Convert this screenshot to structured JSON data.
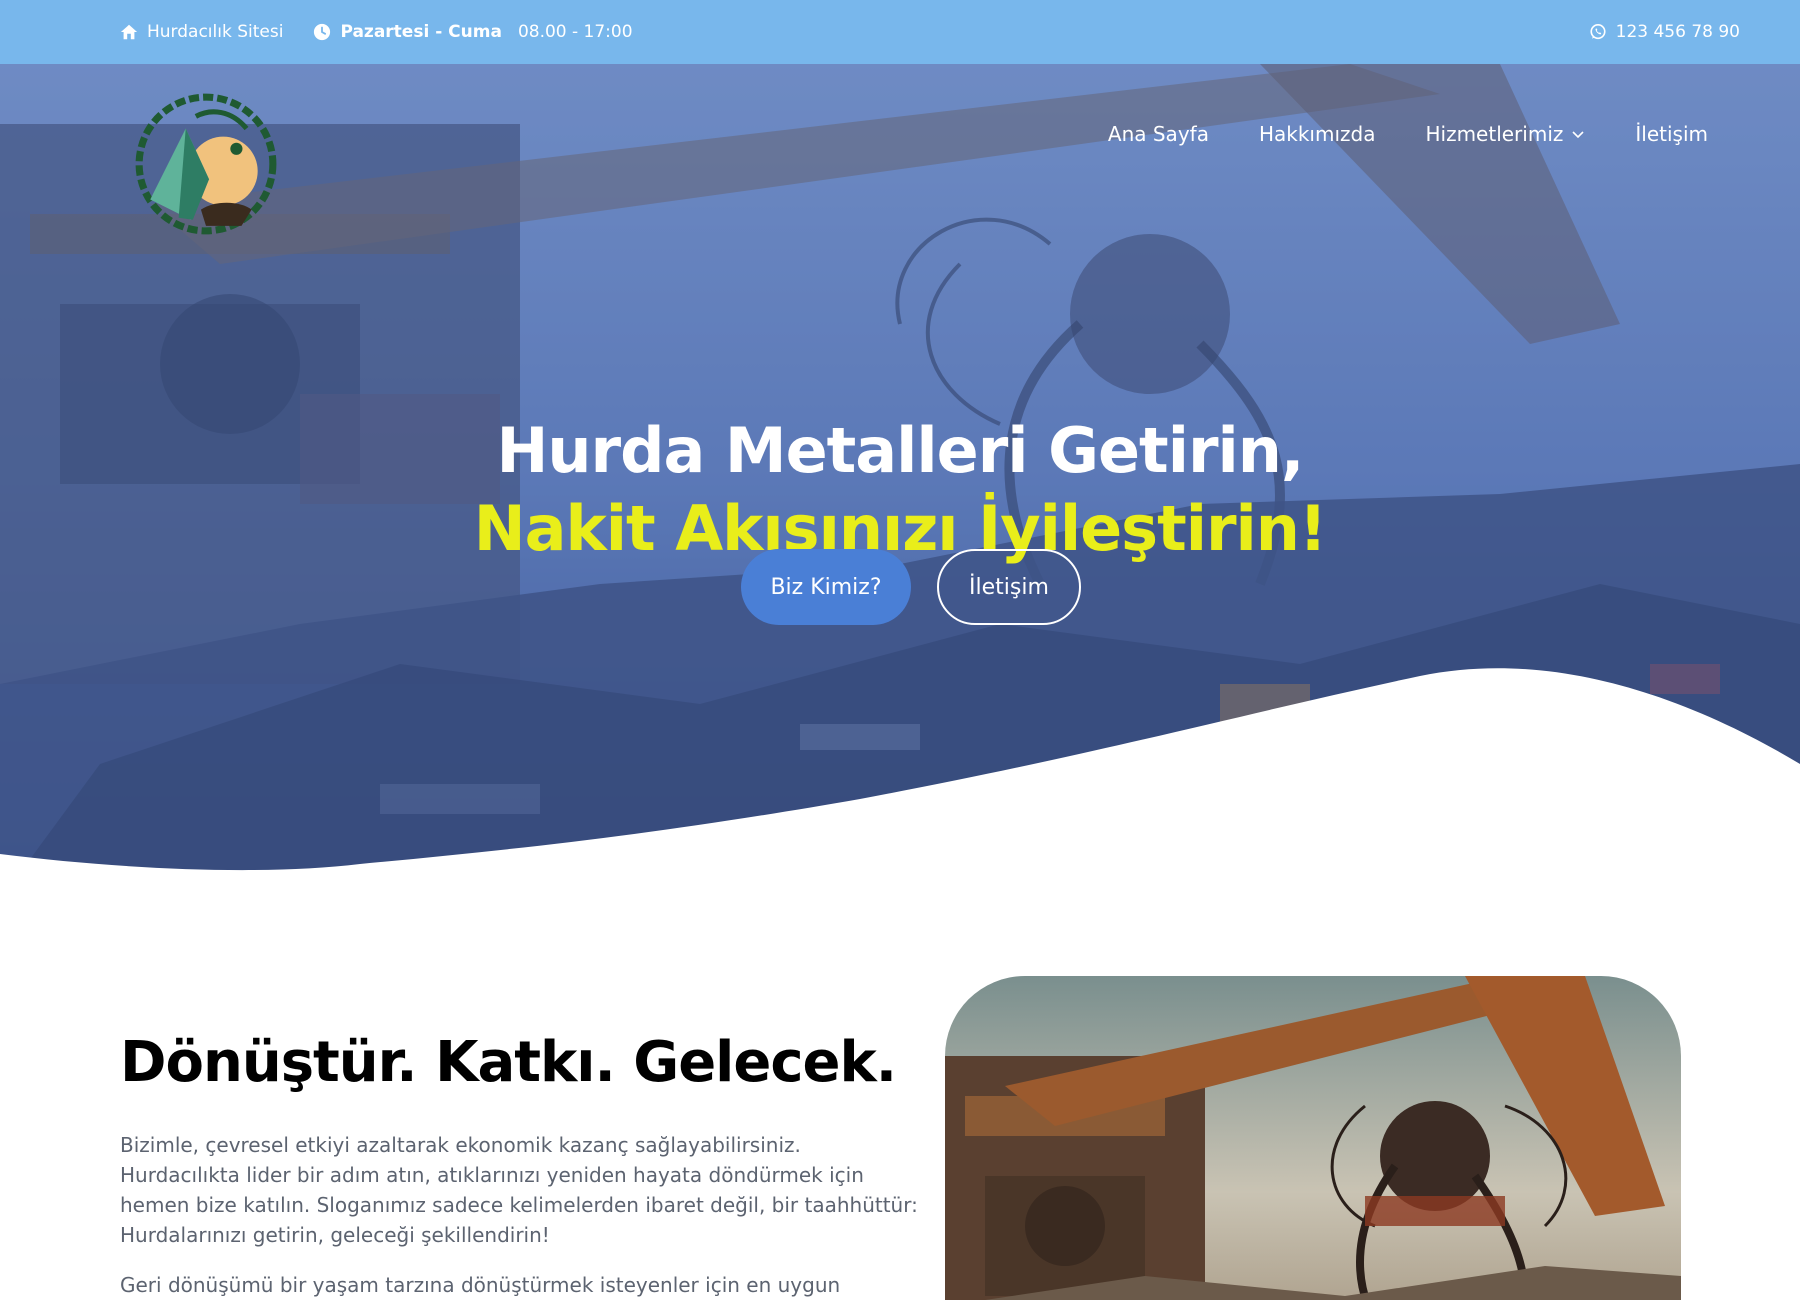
{
  "topbar": {
    "site_name": "Hurdacılık Sitesi",
    "days": "Pazartesi - Cuma",
    "hours": "08.00 - 17:00",
    "phone": "123 456 78 90",
    "background": "#78b7ec"
  },
  "nav": {
    "items": [
      {
        "label": "Ana Sayfa"
      },
      {
        "label": "Hakkımızda"
      },
      {
        "label": "Hizmetlerimiz"
      },
      {
        "label": "İletişim"
      }
    ]
  },
  "hero": {
    "title_line1": "Hurda Metalleri Getirin,",
    "title_line2": "Nakit Akışınızı İyileştirin!",
    "primary_button": "Biz Kimiz?",
    "secondary_button": "İletişim",
    "accent_color": "#e9ee1a",
    "button_color": "#4a7fd6"
  },
  "about": {
    "title": "Dönüştür. Katkı. Gelecek.",
    "paragraph1": "Bizimle, çevresel etkiyi azaltarak ekonomik kazanç sağlayabilirsiniz. Hurdacılıkta lider bir adım atın, atıklarınızı yeniden hayata döndürmek için hemen bize katılın. Sloganımız sadece kelimelerden ibaret değil, bir taahhüttür: Hurdalarınızı getirin, geleceği şekillendirin!",
    "paragraph2": "Geri dönüşümü bir yaşam tarzına dönüştürmek isteyenler için en uygun"
  }
}
